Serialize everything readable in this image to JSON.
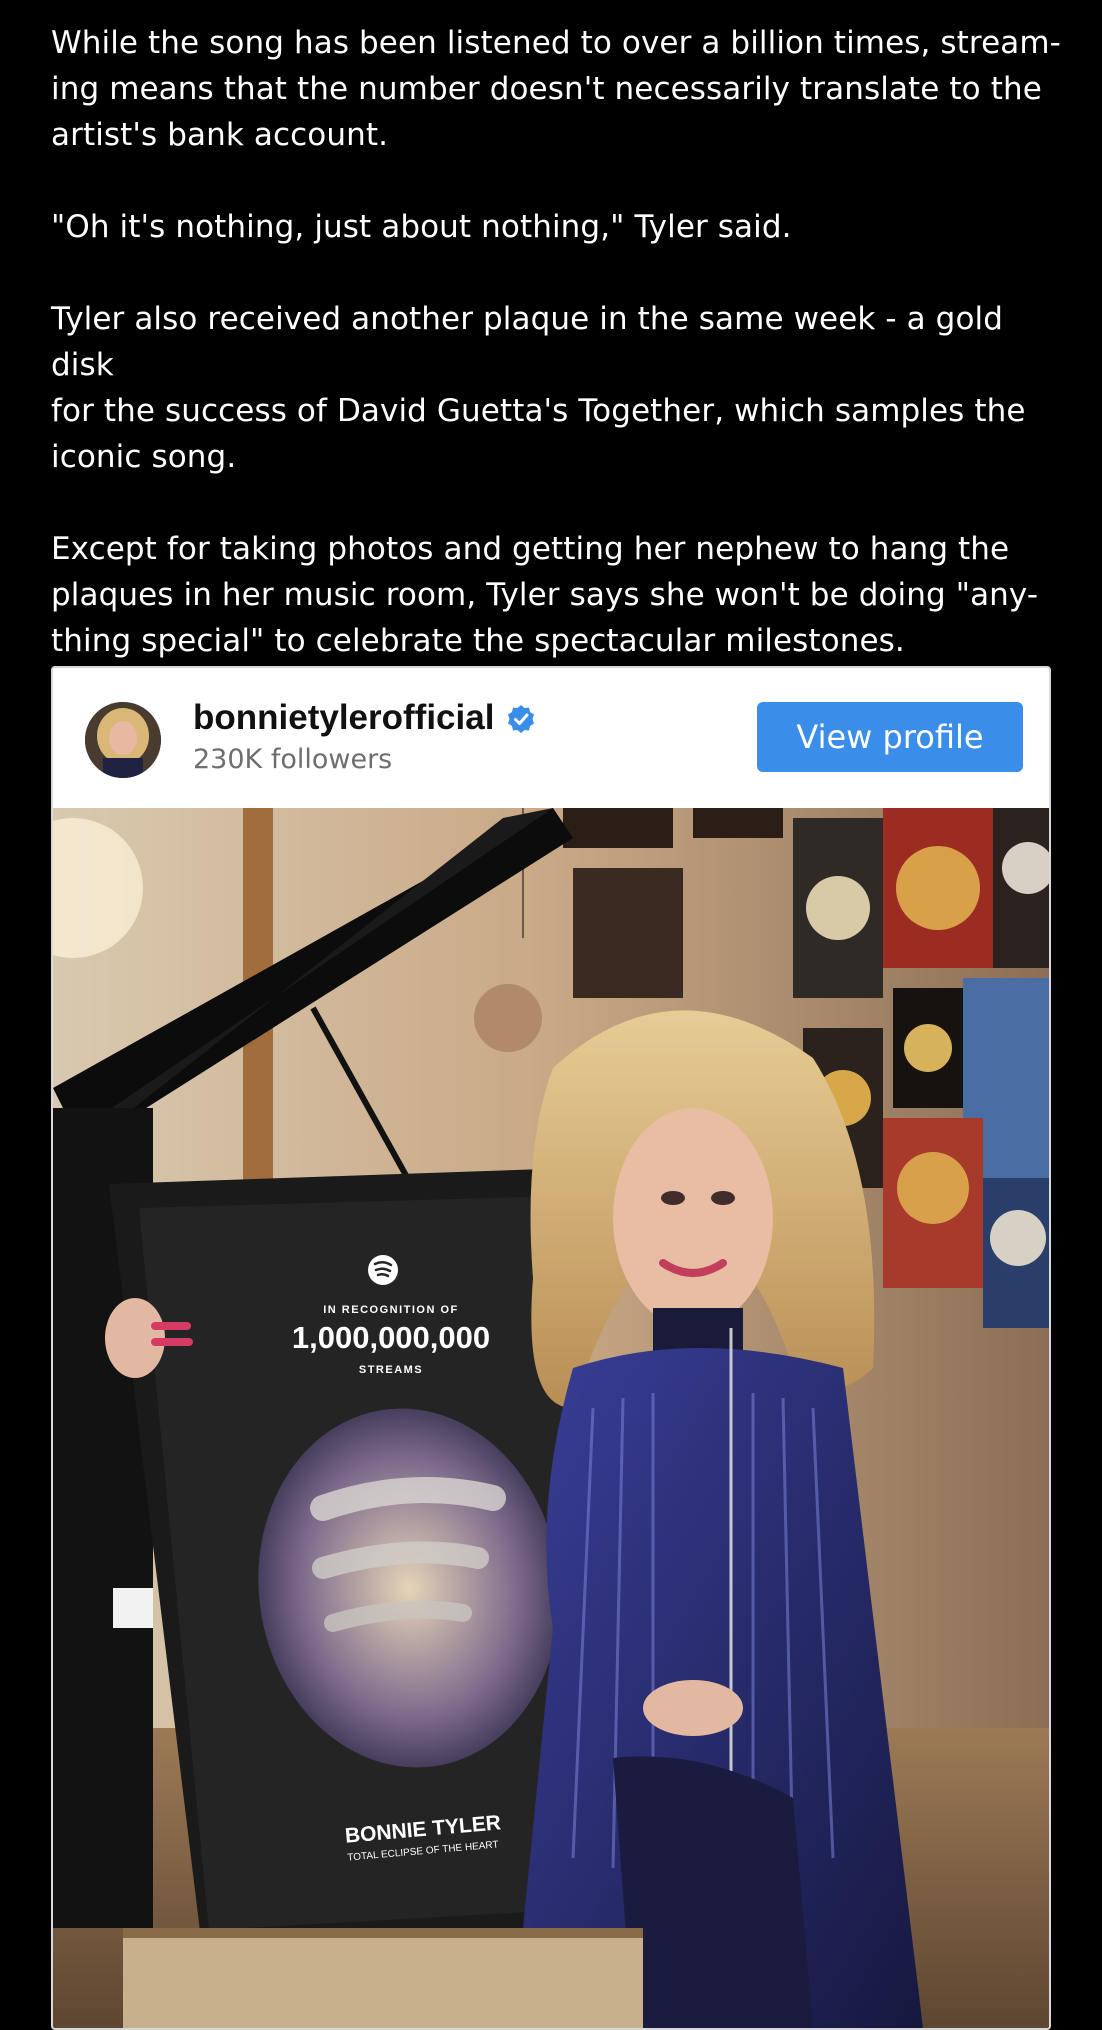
{
  "article": {
    "paragraphs": [
      "While the song has been listened to over a billion times, stream-\ning means that the number doesn't necessarily translate to the\nartist's bank account.",
      "\"Oh it's nothing, just about nothing,\" Tyler said.",
      "Tyler also received another plaque in the same week - a gold disk\nfor the success of David Guetta's Together, which samples the\niconic song.",
      "Except for taking photos and getting her nephew to hang the\nplaques in her music room, Tyler says she won't be doing \"any-\nthing special\" to celebrate the spectacular milestones."
    ]
  },
  "embed": {
    "username": "bonnietylerofficial",
    "followers": "230K followers",
    "view_profile_label": "View profile",
    "verified_icon": "verified-badge-icon",
    "accent_color": "#3a8ee9",
    "photo": {
      "plaque_recognition": "IN RECOGNITION OF",
      "plaque_count": "1,000,000,000",
      "plaque_streams": "STREAMS",
      "plaque_artist": "BONNIE TYLER",
      "plaque_song": "TOTAL ECLIPSE OF THE HEART"
    }
  }
}
